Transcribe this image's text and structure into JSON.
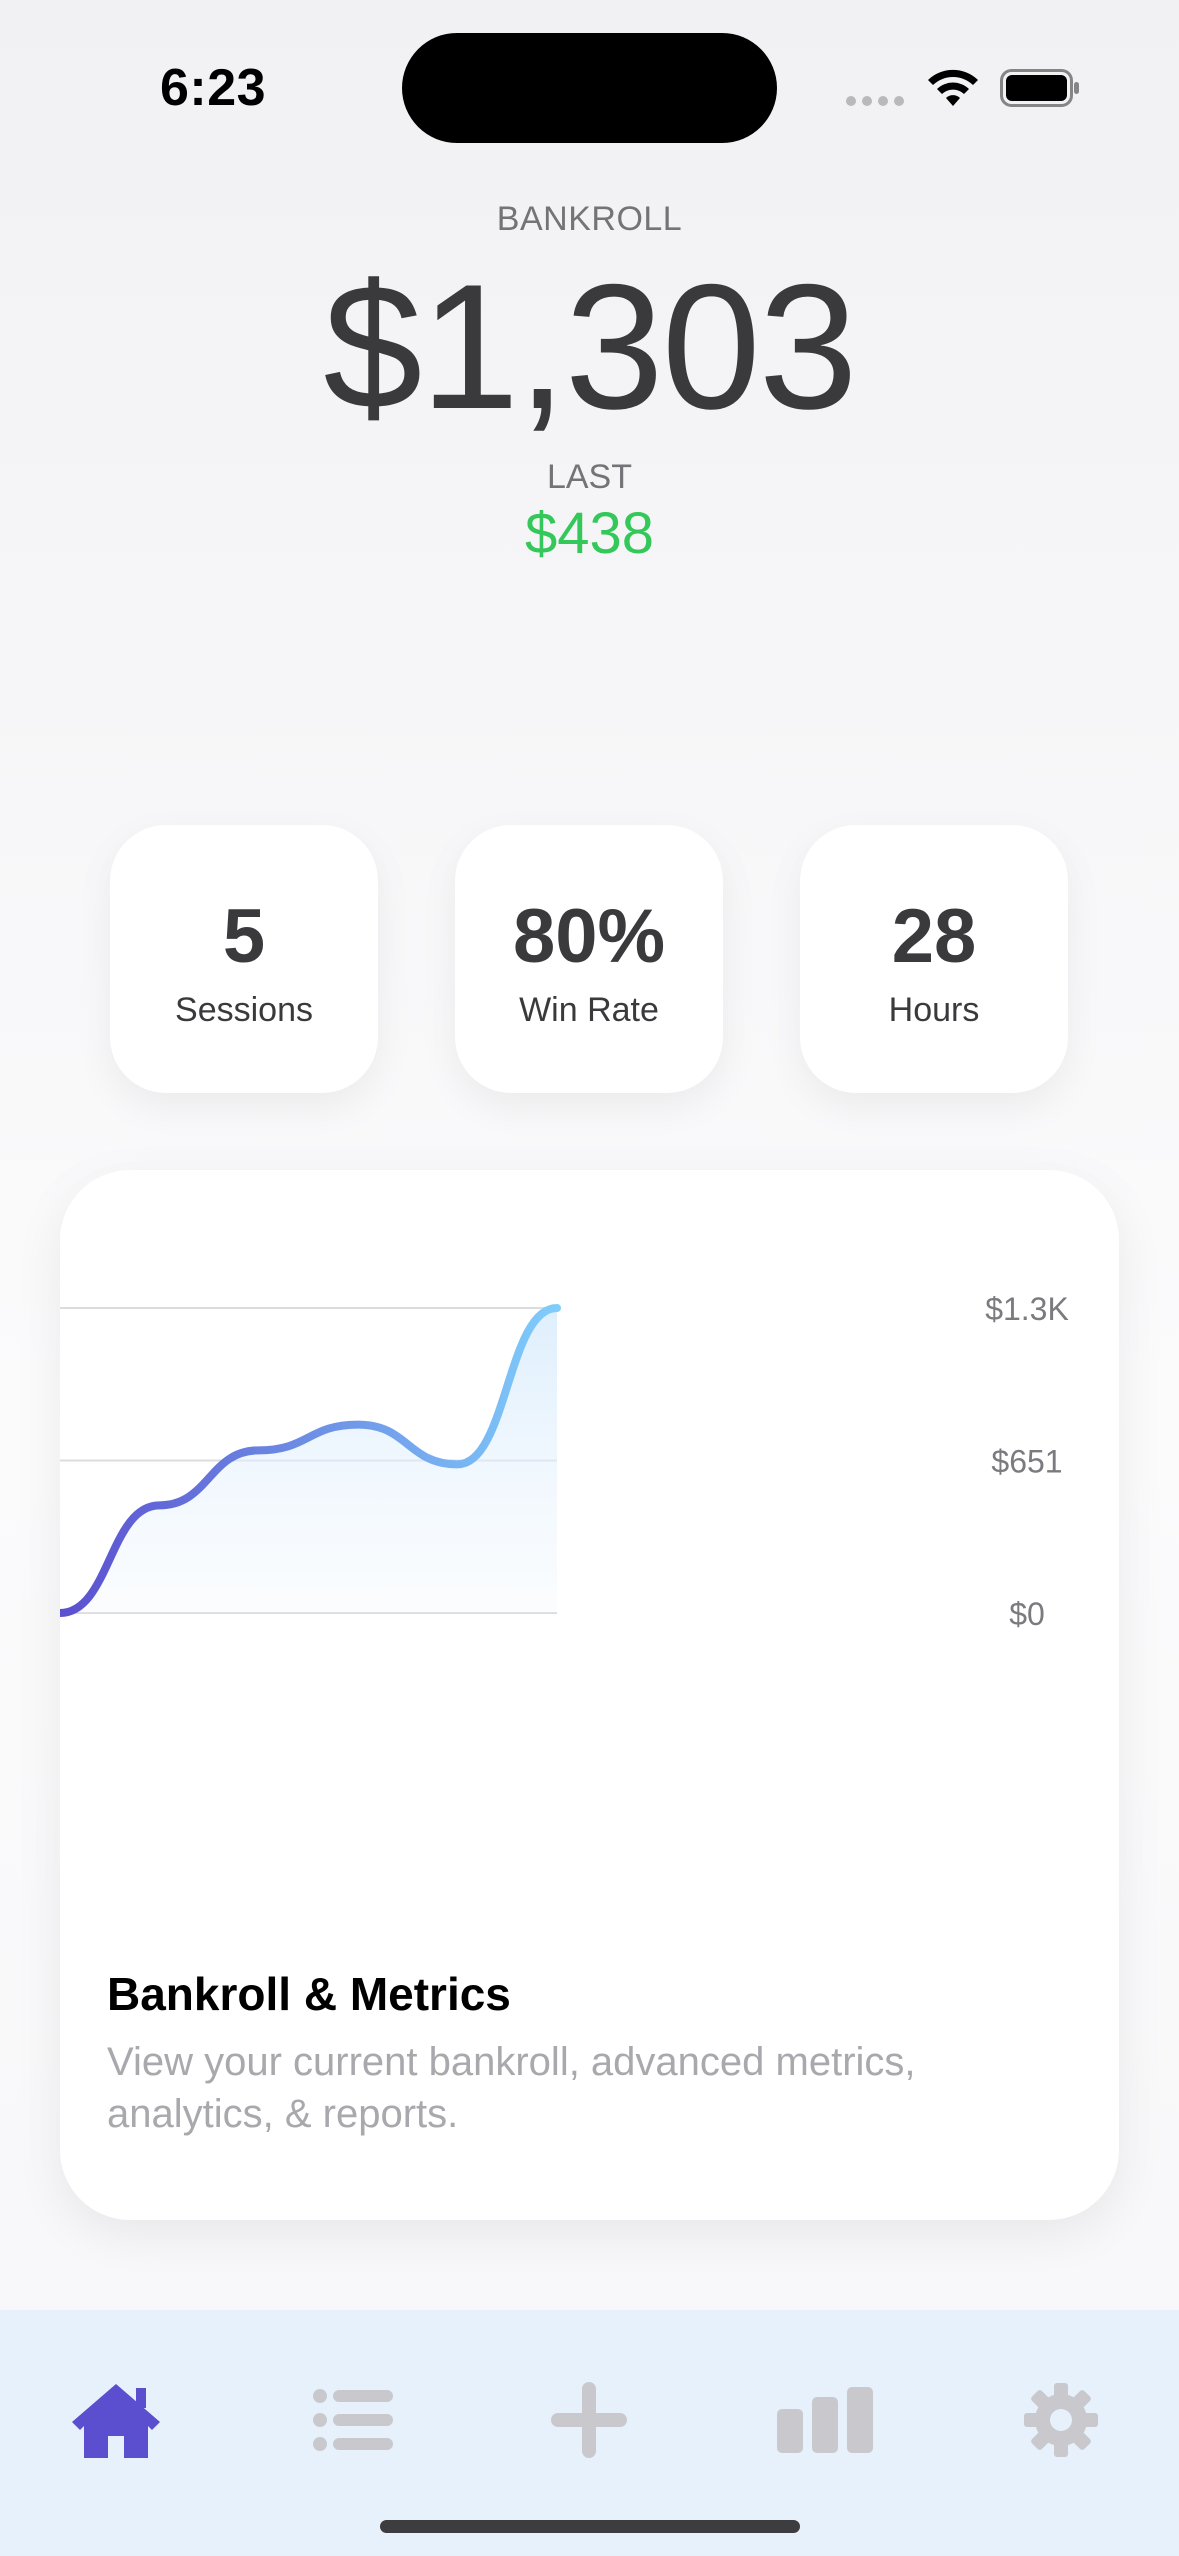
{
  "status_bar": {
    "time": "6:23"
  },
  "header": {
    "bankroll_label": "BANKROLL",
    "bankroll_value": "$1,303",
    "last_label": "LAST",
    "last_value": "$438",
    "last_color": "#34c759"
  },
  "stats": [
    {
      "value": "5",
      "label": "Sessions"
    },
    {
      "value": "80%",
      "label": "Win Rate"
    },
    {
      "value": "28",
      "label": "Hours"
    }
  ],
  "chart_card": {
    "title": "Bankroll & Metrics",
    "description": "View your current bankroll, advanced metrics, analytics, & reports."
  },
  "chart_data": {
    "type": "area",
    "series": [
      {
        "values": [
          0,
          460,
          695,
          805,
          635,
          1303
        ]
      }
    ],
    "ylim": [
      0,
      1303
    ],
    "y_ticks": [
      "$1.3K",
      "$651",
      "$0"
    ],
    "grid": true,
    "colors": [
      "#5b4fcf",
      "#7fcdfb"
    ]
  },
  "tab_bar": {
    "items": [
      {
        "icon": "home-icon",
        "active": true
      },
      {
        "icon": "list-icon",
        "active": false
      },
      {
        "icon": "plus-icon",
        "active": false
      },
      {
        "icon": "bar-chart-icon",
        "active": false
      },
      {
        "icon": "gear-icon",
        "active": false
      }
    ],
    "active_color": "#5b4fcf",
    "inactive_color": "#c9c9cd"
  }
}
